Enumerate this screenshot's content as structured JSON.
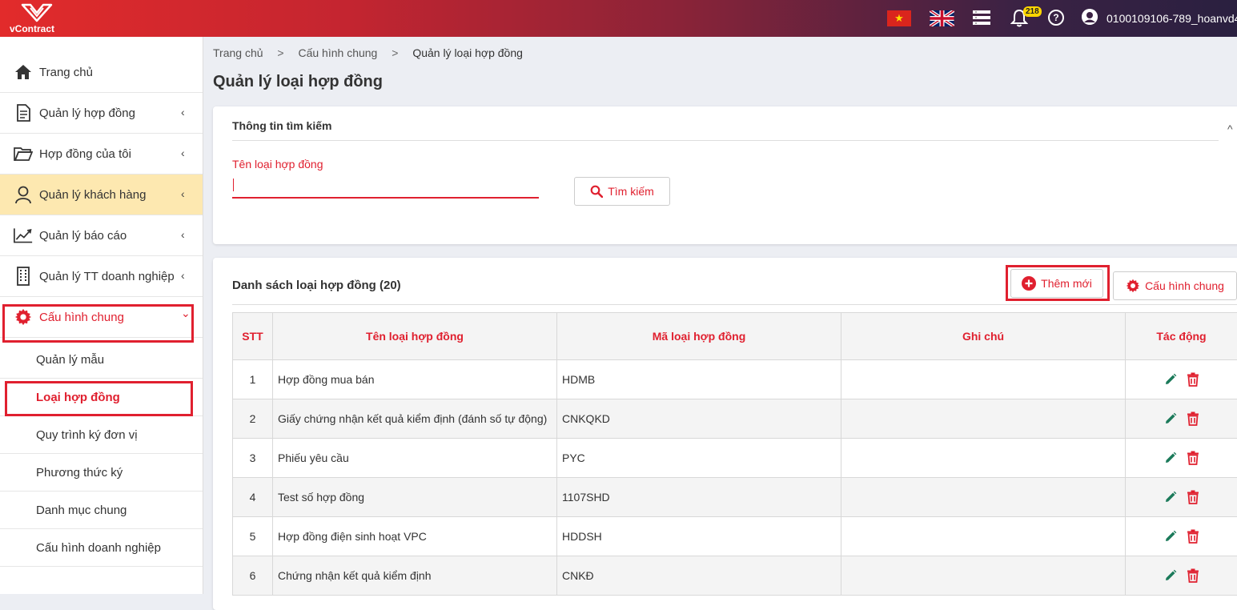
{
  "topbar": {
    "logo_text": "vContract",
    "notification_count": "218",
    "help_symbol": "?",
    "vn_star": "★",
    "user_name": "0100109106-789_hoanvd4",
    "icons": [
      "vietnam-flag-icon",
      "uk-flag-icon",
      "menu-icon",
      "bell-icon",
      "help-icon",
      "user-icon"
    ]
  },
  "sidebar": {
    "items": [
      {
        "label": "Trang chủ",
        "icon": "home-icon"
      },
      {
        "label": "Quản lý hợp đồng",
        "icon": "document-icon",
        "chevron": "‹"
      },
      {
        "label": "Hợp đồng của tôi",
        "icon": "folder-icon",
        "chevron": "‹"
      },
      {
        "label": "Quản lý khách hàng",
        "icon": "user-icon",
        "chevron": "‹"
      },
      {
        "label": "Quản lý báo cáo",
        "icon": "chart-icon",
        "chevron": "‹"
      },
      {
        "label": "Quản lý TT doanh nghiệp",
        "icon": "building-icon",
        "chevron": "‹"
      },
      {
        "label": "Cấu hình chung",
        "icon": "gear-icon",
        "chevron": "⌄"
      }
    ],
    "sub_items": [
      {
        "label": "Quản lý mẫu"
      },
      {
        "label": "Loại hợp đồng"
      },
      {
        "label": "Quy trình ký đơn vị"
      },
      {
        "label": "Phương thức ký"
      },
      {
        "label": "Danh mục chung"
      },
      {
        "label": "Cấu hình doanh nghiệp"
      }
    ]
  },
  "breadcrumb": {
    "items": [
      "Trang chủ",
      "Cấu hình chung",
      "Quản lý loại hợp đồng"
    ],
    "separator": ">"
  },
  "page_title": "Quản lý loại hợp đồng",
  "search": {
    "title": "Thông tin tìm kiếm",
    "field_label": "Tên loại hợp đồng",
    "field_value": "",
    "button_label": "Tìm kiếm",
    "collapse_symbol": "^"
  },
  "list": {
    "title": "Danh sách loại hợp đồng (20)",
    "add_label": "Thêm mới",
    "config_label": "Cấu hình chung",
    "columns": [
      "STT",
      "Tên loại hợp đồng",
      "Mã loại hợp đồng",
      "Ghi chú",
      "Tác động"
    ],
    "rows": [
      {
        "stt": "1",
        "name": "Hợp đồng mua bán",
        "code": "HDMB",
        "note": ""
      },
      {
        "stt": "2",
        "name": "Giấy chứng nhận kết quả kiểm định (đánh số tự động)",
        "code": "CNKQKD",
        "note": ""
      },
      {
        "stt": "3",
        "name": "Phiếu yêu cầu",
        "code": "PYC",
        "note": ""
      },
      {
        "stt": "4",
        "name": "Test số hợp đồng",
        "code": "1107SHD",
        "note": ""
      },
      {
        "stt": "5",
        "name": "Hợp đồng điện sinh hoạt VPC",
        "code": "HDDSH",
        "note": ""
      },
      {
        "stt": "6",
        "name": "Chứng nhận kết quả kiểm định",
        "code": "CNKĐ",
        "note": ""
      }
    ]
  },
  "colors": {
    "accent": "#e0202f",
    "highlight": "#fde8b0",
    "edit": "#1b7a5a"
  }
}
